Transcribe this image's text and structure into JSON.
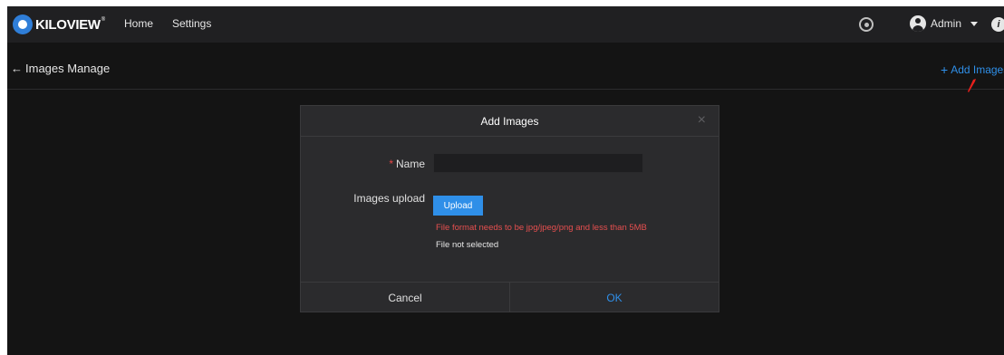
{
  "nav": {
    "logo_text": "KILOVIEW",
    "logo_reg": "®",
    "home": "Home",
    "settings": "Settings",
    "user": "Admin",
    "info": "i"
  },
  "page": {
    "back_arrow": "←",
    "title": "Images Manage",
    "add_plus": "+",
    "add_label": "Add Images"
  },
  "modal": {
    "title": "Add Images",
    "close": "×",
    "required_mark": "*",
    "name_label": "Name",
    "name_value": "",
    "upload_label": "Images upload",
    "upload_button": "Upload",
    "upload_hint": "File format needs to be jpg/jpeg/png and less than 5MB",
    "file_status": "File not selected",
    "cancel": "Cancel",
    "ok": "OK"
  },
  "colors": {
    "accent": "#2f8fe8",
    "error": "#e64f4f",
    "pointer": "#e8201c"
  },
  "icons": [
    "kiloview-logo",
    "help-icon",
    "avatar-icon",
    "chevron-down-icon",
    "info-icon",
    "back-arrow-icon",
    "plus-icon",
    "close-icon",
    "pointer-arrow-icon"
  ]
}
